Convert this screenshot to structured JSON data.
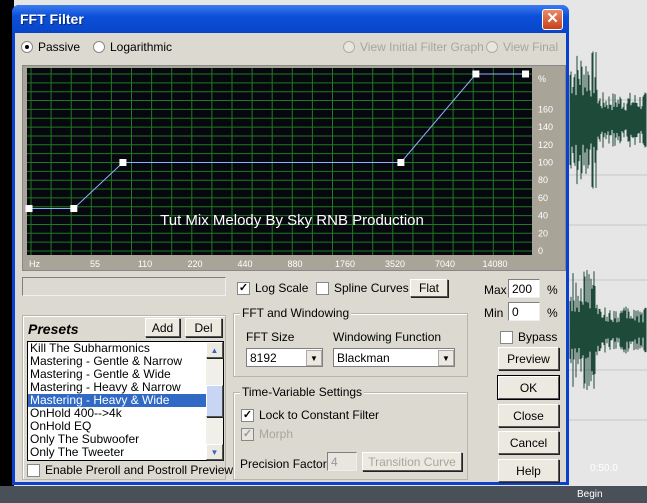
{
  "window": {
    "title": "FFT Filter",
    "close_icon": "close-icon"
  },
  "mode": {
    "passive": "Passive",
    "logarithmic": "Logarithmic",
    "selected": "Passive",
    "view_initial": "View Initial Filter Graph",
    "view_final": "View Final"
  },
  "graph": {
    "watermark": "Tut Mix Melody By Sky RNB Production",
    "x_unit": "Hz",
    "x_ticks": [
      "55",
      "110",
      "220",
      "440",
      "880",
      "1760",
      "3520",
      "7040",
      "14080"
    ],
    "y_unit": "%",
    "y_ticks": [
      "0",
      "20",
      "40",
      "60",
      "80",
      "100",
      "120",
      "140",
      "160"
    ],
    "y_range": [
      0,
      200
    ],
    "points": [
      {
        "hz": 22,
        "pct": 48
      },
      {
        "hz": 41,
        "pct": 48
      },
      {
        "hz": 81,
        "pct": 100
      },
      {
        "hz": 3820,
        "pct": 100
      },
      {
        "hz": 10800,
        "pct": 200
      },
      {
        "hz": 21500,
        "pct": 200
      }
    ],
    "colors": {
      "background": "#07070f",
      "grid": "#1f7a1f",
      "line": "#8fb0ff"
    }
  },
  "options": {
    "log_scale": "Log Scale",
    "log_scale_checked": true,
    "spline": "Spline Curves",
    "spline_checked": false,
    "flat": "Flat",
    "max_label": "Max",
    "max_value": "200",
    "min_label": "Min",
    "min_value": "0",
    "pct": "%"
  },
  "presets": {
    "title": "Presets",
    "add": "Add",
    "del": "Del",
    "selected": "Mastering - Heavy & Wide",
    "items": [
      "Kill The Subharmonics",
      "Mastering - Gentle & Narrow",
      "Mastering - Gentle & Wide",
      "Mastering - Heavy & Narrow",
      "Mastering - Heavy & Wide",
      "OnHold 400-->4k",
      "OnHold EQ",
      "Only The Subwoofer",
      "Only The Tweeter"
    ],
    "preroll": "Enable Preroll and Postroll Preview"
  },
  "fft": {
    "title": "FFT and Windowing",
    "size_label": "FFT Size",
    "size_value": "8192",
    "window_label": "Windowing Function",
    "window_value": "Blackman"
  },
  "timevar": {
    "title": "Time-Variable Settings",
    "lock": "Lock to Constant Filter",
    "morph": "Morph",
    "precision_label": "Precision Factor",
    "precision_value": "4",
    "transition": "Transition Curve"
  },
  "side": {
    "bypass": "Bypass",
    "preview": "Preview",
    "ok": "OK",
    "close": "Close",
    "cancel": "Cancel",
    "help": "Help"
  },
  "background_app": {
    "time": "0:50.0",
    "begin": "Begin"
  }
}
